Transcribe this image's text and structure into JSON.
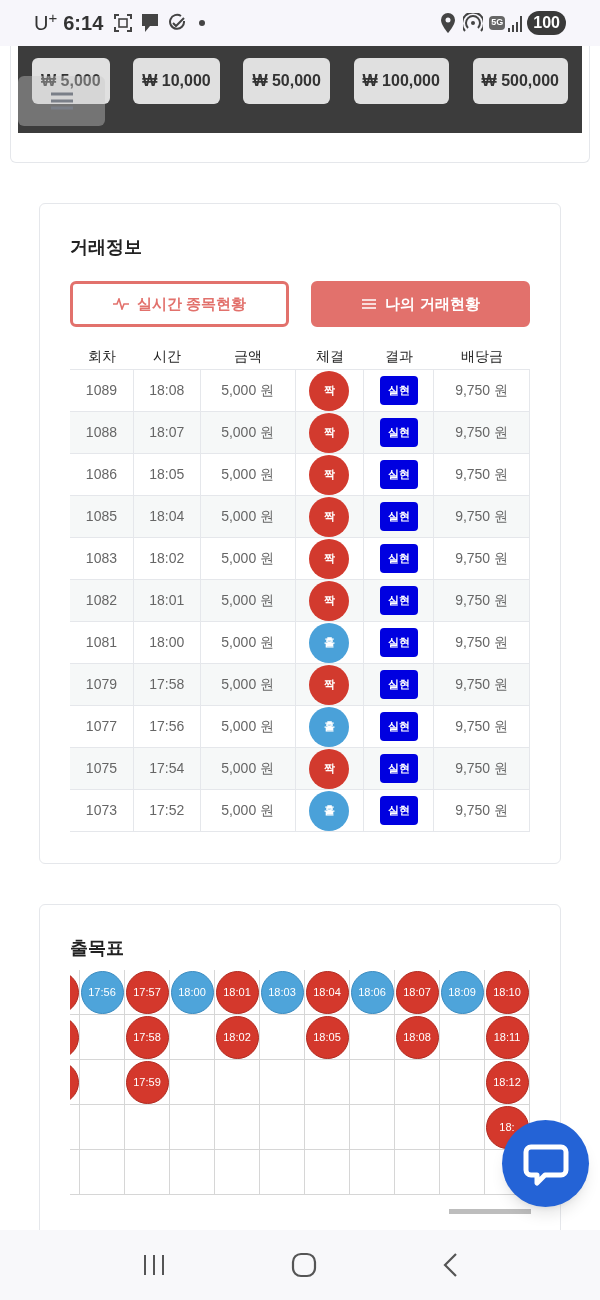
{
  "status_bar": {
    "carrier": "U$^{+}$",
    "time": "6:14",
    "network": "5G",
    "battery": "100"
  },
  "amount_panel": {
    "buttons": [
      "₩ 5,000",
      "₩ 10,000",
      "₩ 50,000",
      "₩ 100,000",
      "₩ 500,000"
    ]
  },
  "trade_info": {
    "title": "거래정보",
    "tabs": [
      {
        "label": "실시간 종목현황",
        "kind": "pulse",
        "selected": false
      },
      {
        "label": "나의 거래현황",
        "kind": "list",
        "selected": true
      }
    ],
    "table": {
      "columns": [
        "회차",
        "시간",
        "금액",
        "체결",
        "결과",
        "배당금"
      ],
      "rows": [
        {
          "round": "1089",
          "time": "18:08",
          "amount": "5,000 원",
          "bet": {
            "kind": "even",
            "label": "짝"
          },
          "result": "실현",
          "payout": "9,750 원"
        },
        {
          "round": "1088",
          "time": "18:07",
          "amount": "5,000 원",
          "bet": {
            "kind": "even",
            "label": "짝"
          },
          "result": "실현",
          "payout": "9,750 원"
        },
        {
          "round": "1086",
          "time": "18:05",
          "amount": "5,000 원",
          "bet": {
            "kind": "even",
            "label": "짝"
          },
          "result": "실현",
          "payout": "9,750 원"
        },
        {
          "round": "1085",
          "time": "18:04",
          "amount": "5,000 원",
          "bet": {
            "kind": "even",
            "label": "짝"
          },
          "result": "실현",
          "payout": "9,750 원"
        },
        {
          "round": "1083",
          "time": "18:02",
          "amount": "5,000 원",
          "bet": {
            "kind": "even",
            "label": "짝"
          },
          "result": "실현",
          "payout": "9,750 원"
        },
        {
          "round": "1082",
          "time": "18:01",
          "amount": "5,000 원",
          "bet": {
            "kind": "even",
            "label": "짝"
          },
          "result": "실현",
          "payout": "9,750 원"
        },
        {
          "round": "1081",
          "time": "18:00",
          "amount": "5,000 원",
          "bet": {
            "kind": "odd",
            "label": "홀"
          },
          "result": "실현",
          "payout": "9,750 원"
        },
        {
          "round": "1079",
          "time": "17:58",
          "amount": "5,000 원",
          "bet": {
            "kind": "even",
            "label": "짝"
          },
          "result": "실현",
          "payout": "9,750 원"
        },
        {
          "round": "1077",
          "time": "17:56",
          "amount": "5,000 원",
          "bet": {
            "kind": "odd",
            "label": "홀"
          },
          "result": "실현",
          "payout": "9,750 원"
        },
        {
          "round": "1075",
          "time": "17:54",
          "amount": "5,000 원",
          "bet": {
            "kind": "even",
            "label": "짝"
          },
          "result": "실현",
          "payout": "9,750 원"
        },
        {
          "round": "1073",
          "time": "17:52",
          "amount": "5,000 원",
          "bet": {
            "kind": "odd",
            "label": "홀"
          },
          "result": "실현",
          "payout": "9,750 원"
        }
      ]
    }
  },
  "result_board": {
    "title": "출목표",
    "columns": [
      {
        "cells": [
          {
            "kind": "even"
          },
          {
            "kind": "even"
          },
          {
            "kind": "even"
          }
        ]
      },
      {
        "cells": [
          {
            "kind": "odd",
            "label": "17:56"
          }
        ]
      },
      {
        "cells": [
          {
            "kind": "even",
            "label": "17:57"
          },
          {
            "kind": "even",
            "label": "17:58"
          },
          {
            "kind": "even",
            "label": "17:59"
          }
        ]
      },
      {
        "cells": [
          {
            "kind": "odd",
            "label": "18:00"
          }
        ]
      },
      {
        "cells": [
          {
            "kind": "even",
            "label": "18:01"
          },
          {
            "kind": "even",
            "label": "18:02"
          }
        ]
      },
      {
        "cells": [
          {
            "kind": "odd",
            "label": "18:03"
          }
        ]
      },
      {
        "cells": [
          {
            "kind": "even",
            "label": "18:04"
          },
          {
            "kind": "even",
            "label": "18:05"
          }
        ]
      },
      {
        "cells": [
          {
            "kind": "odd",
            "label": "18:06"
          }
        ]
      },
      {
        "cells": [
          {
            "kind": "even",
            "label": "18:07"
          },
          {
            "kind": "even",
            "label": "18:08"
          }
        ]
      },
      {
        "cells": [
          {
            "kind": "odd",
            "label": "18:09"
          }
        ]
      },
      {
        "cells": [
          {
            "kind": "even",
            "label": "18:10"
          },
          {
            "kind": "even",
            "label": "18:11"
          },
          {
            "kind": "even",
            "label": "18:12"
          },
          {
            "kind": "even",
            "label": "18:"
          }
        ]
      }
    ]
  }
}
